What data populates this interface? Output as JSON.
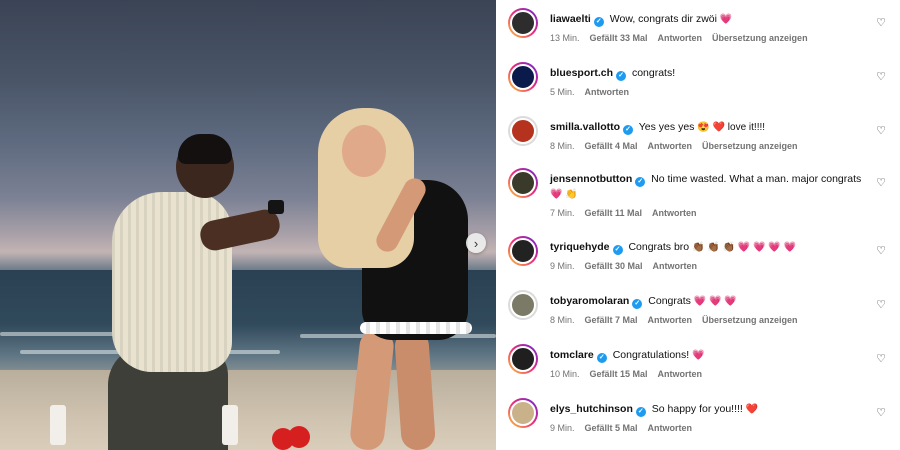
{
  "photo": {
    "next_arrow": "›",
    "icons": {
      "next": "chevron-right-icon"
    }
  },
  "comments": [
    {
      "user": "liawaelti",
      "verified": true,
      "text": "Wow, congrats dir zwöi",
      "emoji": "💗",
      "time": "13 Min.",
      "likes": "Gefällt 33 Mal",
      "reply": "Antworten",
      "translate": "Übersetzung anzeigen",
      "avatar_ring": true,
      "avatar_color": "#2d2d2d"
    },
    {
      "user": "bluesport.ch",
      "verified": true,
      "text": "congrats!",
      "emoji": "",
      "time": "5 Min.",
      "likes": "",
      "reply": "Antworten",
      "translate": "",
      "avatar_ring": true,
      "avatar_color": "#0a1a4a"
    },
    {
      "user": "smilla.vallotto",
      "verified": true,
      "text": "Yes yes yes",
      "emoji": "😍 ❤️ love it!!!!",
      "time": "8 Min.",
      "likes": "Gefällt 4 Mal",
      "reply": "Antworten",
      "translate": "Übersetzung anzeigen",
      "avatar_ring": false,
      "avatar_color": "#b5321f"
    },
    {
      "user": "jensennotbutton",
      "verified": true,
      "text": "No time wasted. What a man. major congrats",
      "emoji": "💗 👏",
      "time": "7 Min.",
      "likes": "Gefällt 11 Mal",
      "reply": "Antworten",
      "translate": "",
      "avatar_ring": true,
      "avatar_color": "#3a3a2a"
    },
    {
      "user": "tyriquehyde",
      "verified": true,
      "text": "Congrats bro",
      "emoji": "👏🏾 👏🏾 👏🏾 💗 💗 💗 💗",
      "time": "9 Min.",
      "likes": "Gefällt 30 Mal",
      "reply": "Antworten",
      "translate": "",
      "avatar_ring": true,
      "avatar_color": "#222222"
    },
    {
      "user": "tobyaromolaran",
      "verified": true,
      "text": "Congrats",
      "emoji": "💗 💗 💗",
      "time": "8 Min.",
      "likes": "Gefällt 7 Mal",
      "reply": "Antworten",
      "translate": "Übersetzung anzeigen",
      "avatar_ring": false,
      "avatar_color": "#7a7a66"
    },
    {
      "user": "tomclare",
      "verified": true,
      "text": "Congratulations!",
      "emoji": "💗",
      "time": "10 Min.",
      "likes": "Gefällt 15 Mal",
      "reply": "Antworten",
      "translate": "",
      "avatar_ring": true,
      "avatar_color": "#1f1f1f"
    },
    {
      "user": "elys_hutchinson",
      "verified": true,
      "text": "So happy for you!!!!",
      "emoji": "❤️",
      "time": "9 Min.",
      "likes": "Gefällt 5 Mal",
      "reply": "Antworten",
      "translate": "",
      "avatar_ring": true,
      "avatar_color": "#c9b18a"
    }
  ],
  "icons": {
    "like": "heart-outline-icon",
    "verified": "verified-badge-icon"
  }
}
